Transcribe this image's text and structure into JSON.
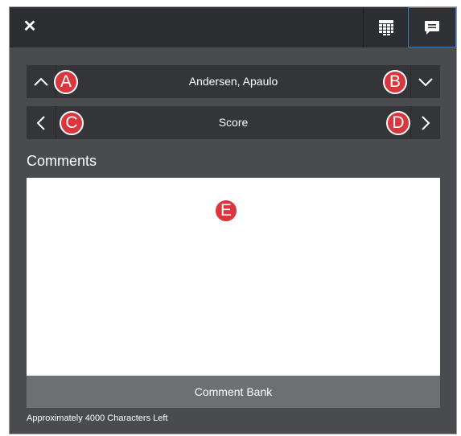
{
  "toolbar": {
    "close_icon": "close-icon",
    "grid_icon": "grid-icon",
    "comment_icon": "comment-icon",
    "active_accent": "#3a78c2"
  },
  "student_nav": {
    "name": "Andersen, Apaulo",
    "prev_icon": "chevron-up-icon",
    "next_icon": "chevron-down-icon"
  },
  "field_nav": {
    "label": "Score",
    "prev_icon": "chevron-left-icon",
    "next_icon": "chevron-right-icon"
  },
  "comments": {
    "title": "Comments",
    "value": "",
    "bank_label": "Comment Bank",
    "chars_left": "Approximately 4000 Characters Left"
  },
  "callouts": {
    "a": "A",
    "b": "B",
    "c": "C",
    "d": "D",
    "e": "E",
    "color": "#d9363e"
  }
}
